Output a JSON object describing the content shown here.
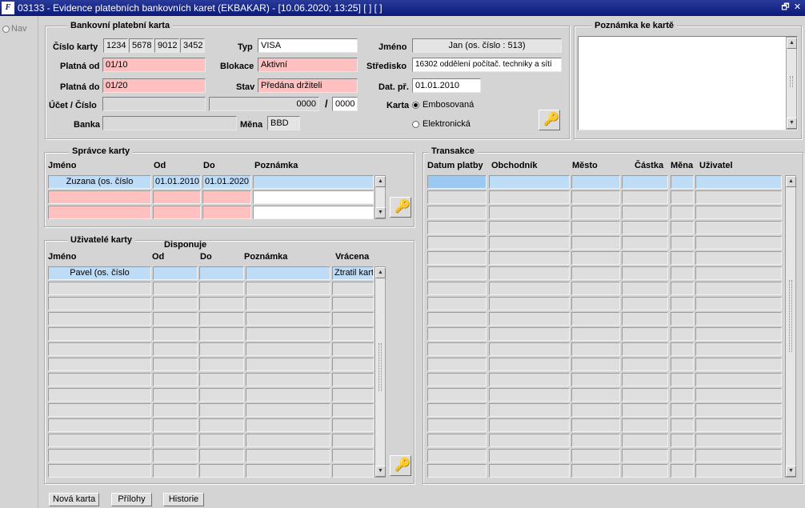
{
  "window": {
    "title": "03133 - Evidence platebních bankovních karet (EKBAKAR) - [10.06.2020; 13:25]  [ ]  [ ]",
    "app_icon": "F",
    "restore_glyph": "🗗",
    "close_glyph": "✕"
  },
  "nav": {
    "label": "Nav"
  },
  "card": {
    "title": "Bankovní platební karta",
    "cislo_label": "Číslo karty",
    "cislo_parts": [
      "1234",
      "5678",
      "9012",
      "3452"
    ],
    "platna_od_label": "Platná od",
    "platna_od": "01/10",
    "platna_do_label": "Platná do",
    "platna_do": "01/20",
    "ucet_label": "Účet / Číslo",
    "ucet": "",
    "cislo_uctu": "0000",
    "slash": "/",
    "kod_banky": "0000",
    "banka_label": "Banka",
    "banka": "",
    "typ_label": "Typ",
    "typ": "VISA",
    "blokace_label": "Blokace",
    "blokace": "Aktivní",
    "stav_label": "Stav",
    "stav": "Předána držiteli",
    "mena_label": "Měna",
    "mena": "BBD",
    "jmeno_label": "Jméno",
    "jmeno": "Jan   (os. číslo :     513)",
    "stredisko_label": "Středisko",
    "stredisko": "16302 oddělení počítač. techniky a sítí",
    "dat_label": "Dat. př.",
    "dat": "01.01.2010",
    "karta_label": "Karta",
    "karta_opt1": "Embosovaná",
    "karta_opt2": "Elektronická"
  },
  "note": {
    "title": "Poznámka ke kartě",
    "text": ""
  },
  "spravce": {
    "title": "Správce karty",
    "headers": [
      "Jméno",
      "Od",
      "Do",
      "Poznámka"
    ],
    "rows": [
      [
        "Zuzana   (os. číslo",
        "01.01.2010",
        "01.01.2020",
        ""
      ],
      [
        "",
        "",
        "",
        ""
      ],
      [
        "",
        "",
        "",
        ""
      ]
    ]
  },
  "uzivatele": {
    "title": "Uživatelé karty",
    "disponuje": "Disponuje",
    "headers": [
      "Jméno",
      "Od",
      "Do",
      "Poznámka",
      "Vrácena"
    ],
    "rows": [
      [
        "Pavel   (os. číslo",
        "",
        "",
        "",
        "Ztratil kartu"
      ],
      [
        "",
        "",
        "",
        "",
        ""
      ],
      [
        "",
        "",
        "",
        "",
        ""
      ],
      [
        "",
        "",
        "",
        "",
        ""
      ],
      [
        "",
        "",
        "",
        "",
        ""
      ],
      [
        "",
        "",
        "",
        "",
        ""
      ],
      [
        "",
        "",
        "",
        "",
        ""
      ],
      [
        "",
        "",
        "",
        "",
        ""
      ],
      [
        "",
        "",
        "",
        "",
        ""
      ],
      [
        "",
        "",
        "",
        "",
        ""
      ],
      [
        "",
        "",
        "",
        "",
        ""
      ],
      [
        "",
        "",
        "",
        "",
        ""
      ],
      [
        "",
        "",
        "",
        "",
        ""
      ],
      [
        "",
        "",
        "",
        "",
        ""
      ]
    ]
  },
  "transakce": {
    "title": "Transakce",
    "headers": [
      "Datum platby",
      "Obchodník",
      "Město",
      "Částka",
      "Měna",
      "Uživatel"
    ],
    "row_count": 20
  },
  "buttons": {
    "nova": "Nová karta",
    "prilohy": "Přílohy",
    "historie": "Historie"
  },
  "icons": {
    "key": "key-icon",
    "scroll_up": "▲",
    "scroll_down": "▼",
    "key_glyph": "🔑"
  }
}
